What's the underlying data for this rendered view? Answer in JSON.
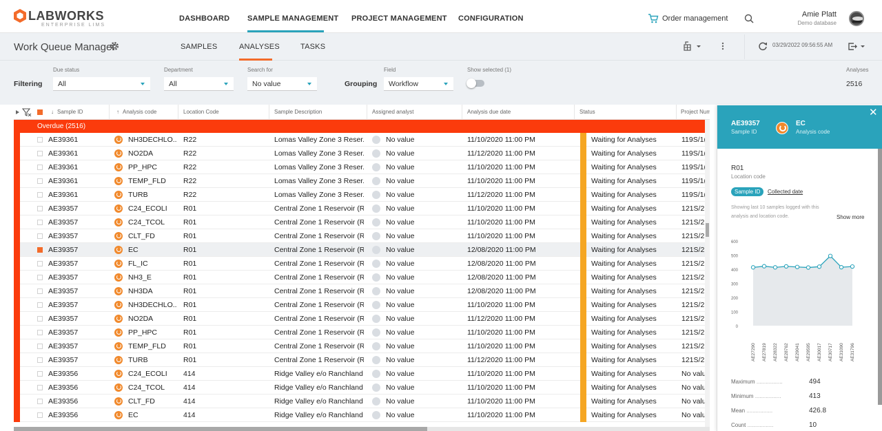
{
  "brand": {
    "name": "LABWORKS",
    "tagline": "ENTERPRISE LIMS"
  },
  "nav": {
    "items": [
      {
        "label": "DASHBOARD"
      },
      {
        "label": "SAMPLE MANAGEMENT",
        "active": true
      },
      {
        "label": "PROJECT MANAGEMENT"
      },
      {
        "label": "CONFIGURATION"
      }
    ],
    "order_label": "Order management",
    "user": {
      "name": "Amie Platt",
      "database": "Demo database"
    }
  },
  "subheader": {
    "title": "Work Queue Manager",
    "tabs": [
      {
        "label": "SAMPLES"
      },
      {
        "label": "ANALYSES",
        "active": true
      },
      {
        "label": "TASKS"
      }
    ],
    "refresh_time": "03/29/2022 09:56:55 AM"
  },
  "filters": {
    "filtering_label": "Filtering",
    "grouping_label": "Grouping",
    "due_status": {
      "label": "Due status",
      "value": "All"
    },
    "department": {
      "label": "Department",
      "value": "All"
    },
    "search_for": {
      "label": "Search for",
      "value": "No value"
    },
    "field": {
      "label": "Field",
      "value": "Workflow"
    },
    "show_selected": {
      "label": "Show selected (1)"
    },
    "analyses": {
      "label": "Analyses",
      "count": "2516"
    }
  },
  "grid": {
    "columns": {
      "sample_id": "Sample ID",
      "analysis_code": "Analysis code",
      "location_code": "Location Code",
      "sample_description": "Sample Description",
      "assigned_analyst": "Assigned analyst",
      "due_date": "Analysis due date",
      "status": "Status",
      "project": "Project Num"
    },
    "group_label": "Overdue (2516)",
    "rows": [
      {
        "sample": "AE39361",
        "analysis": "NH3DECHLO...",
        "loc": "R22",
        "desc": "Lomas Valley Zone 3 Reser...",
        "analyst": "No value",
        "due": "11/10/2020 11:00 PM",
        "status": "Waiting for Analyses",
        "project": "119S/1("
      },
      {
        "sample": "AE39361",
        "analysis": "NO2DA",
        "loc": "R22",
        "desc": "Lomas Valley Zone 3 Reser...",
        "analyst": "No value",
        "due": "11/12/2020 11:00 PM",
        "status": "Waiting for Analyses",
        "project": "119S/1("
      },
      {
        "sample": "AE39361",
        "analysis": "PP_HPC",
        "loc": "R22",
        "desc": "Lomas Valley Zone 3 Reser...",
        "analyst": "No value",
        "due": "11/10/2020 11:00 PM",
        "status": "Waiting for Analyses",
        "project": "119S/1("
      },
      {
        "sample": "AE39361",
        "analysis": "TEMP_FLD",
        "loc": "R22",
        "desc": "Lomas Valley Zone 3 Reser...",
        "analyst": "No value",
        "due": "11/10/2020 11:00 PM",
        "status": "Waiting for Analyses",
        "project": "119S/1("
      },
      {
        "sample": "AE39361",
        "analysis": "TURB",
        "loc": "R22",
        "desc": "Lomas Valley Zone 3 Reser...",
        "analyst": "No value",
        "due": "11/12/2020 11:00 PM",
        "status": "Waiting for Analyses",
        "project": "119S/1("
      },
      {
        "sample": "AE39357",
        "analysis": "C24_ECOLI",
        "loc": "R01",
        "desc": "Central Zone 1 Reservoir (R...",
        "analyst": "No value",
        "due": "11/10/2020 11:00 PM",
        "status": "Waiting for Analyses",
        "project": "121S/2"
      },
      {
        "sample": "AE39357",
        "analysis": "C24_TCOL",
        "loc": "R01",
        "desc": "Central Zone 1 Reservoir (R...",
        "analyst": "No value",
        "due": "11/10/2020 11:00 PM",
        "status": "Waiting for Analyses",
        "project": "121S/2"
      },
      {
        "sample": "AE39357",
        "analysis": "CLT_FD",
        "loc": "R01",
        "desc": "Central Zone 1 Reservoir (R...",
        "analyst": "No value",
        "due": "11/10/2020 11:00 PM",
        "status": "Waiting for Analyses",
        "project": "121S/2"
      },
      {
        "sample": "AE39357",
        "analysis": "EC",
        "loc": "R01",
        "desc": "Central Zone 1 Reservoir (R...",
        "analyst": "No value",
        "due": "12/08/2020 11:00 PM",
        "status": "Waiting for Analyses",
        "project": "121S/2",
        "selected": true
      },
      {
        "sample": "AE39357",
        "analysis": "FL_IC",
        "loc": "R01",
        "desc": "Central Zone 1 Reservoir (R...",
        "analyst": "No value",
        "due": "12/08/2020 11:00 PM",
        "status": "Waiting for Analyses",
        "project": "121S/2"
      },
      {
        "sample": "AE39357",
        "analysis": "NH3_E",
        "loc": "R01",
        "desc": "Central Zone 1 Reservoir (R...",
        "analyst": "No value",
        "due": "12/08/2020 11:00 PM",
        "status": "Waiting for Analyses",
        "project": "121S/2"
      },
      {
        "sample": "AE39357",
        "analysis": "NH3DA",
        "loc": "R01",
        "desc": "Central Zone 1 Reservoir (R...",
        "analyst": "No value",
        "due": "12/08/2020 11:00 PM",
        "status": "Waiting for Analyses",
        "project": "121S/2"
      },
      {
        "sample": "AE39357",
        "analysis": "NH3DECHLO...",
        "loc": "R01",
        "desc": "Central Zone 1 Reservoir (R...",
        "analyst": "No value",
        "due": "11/10/2020 11:00 PM",
        "status": "Waiting for Analyses",
        "project": "121S/2"
      },
      {
        "sample": "AE39357",
        "analysis": "NO2DA",
        "loc": "R01",
        "desc": "Central Zone 1 Reservoir (R...",
        "analyst": "No value",
        "due": "11/12/2020 11:00 PM",
        "status": "Waiting for Analyses",
        "project": "121S/2"
      },
      {
        "sample": "AE39357",
        "analysis": "PP_HPC",
        "loc": "R01",
        "desc": "Central Zone 1 Reservoir (R...",
        "analyst": "No value",
        "due": "11/10/2020 11:00 PM",
        "status": "Waiting for Analyses",
        "project": "121S/2"
      },
      {
        "sample": "AE39357",
        "analysis": "TEMP_FLD",
        "loc": "R01",
        "desc": "Central Zone 1 Reservoir (R...",
        "analyst": "No value",
        "due": "11/10/2020 11:00 PM",
        "status": "Waiting for Analyses",
        "project": "121S/2"
      },
      {
        "sample": "AE39357",
        "analysis": "TURB",
        "loc": "R01",
        "desc": "Central Zone 1 Reservoir (R...",
        "analyst": "No value",
        "due": "11/12/2020 11:00 PM",
        "status": "Waiting for Analyses",
        "project": "121S/2"
      },
      {
        "sample": "AE39356",
        "analysis": "C24_ECOLI",
        "loc": "414",
        "desc": "Ridge Valley e/o Ranchland",
        "analyst": "No value",
        "due": "11/10/2020 11:00 PM",
        "status": "Waiting for Analyses",
        "project": "No valu"
      },
      {
        "sample": "AE39356",
        "analysis": "C24_TCOL",
        "loc": "414",
        "desc": "Ridge Valley e/o Ranchland",
        "analyst": "No value",
        "due": "11/10/2020 11:00 PM",
        "status": "Waiting for Analyses",
        "project": "No valu"
      },
      {
        "sample": "AE39356",
        "analysis": "CLT_FD",
        "loc": "414",
        "desc": "Ridge Valley e/o Ranchland",
        "analyst": "No value",
        "due": "11/10/2020 11:00 PM",
        "status": "Waiting for Analyses",
        "project": "No valu"
      },
      {
        "sample": "AE39356",
        "analysis": "EC",
        "loc": "414",
        "desc": "Ridge Valley e/o Ranchland",
        "analyst": "No value",
        "due": "11/10/2020 11:00 PM",
        "status": "Waiting for Analyses",
        "project": "No valu"
      }
    ]
  },
  "panel": {
    "sample_id": "AE39357",
    "sample_id_label": "Sample ID",
    "analysis_code": "EC",
    "analysis_code_label": "Analysis code",
    "location": "R01",
    "location_label": "Location code",
    "tab_sample": "Sample ID",
    "tab_collected": "Collected date",
    "note": "Showing last 10 samples logged with this analysis and location code.",
    "show_more": "Show more",
    "stats": [
      {
        "label": "Maximum",
        "value": "494"
      },
      {
        "label": "Minimum",
        "value": "413"
      },
      {
        "label": "Mean",
        "value": "426.8"
      },
      {
        "label": "Count",
        "value": "10"
      }
    ]
  },
  "chart_data": {
    "type": "area",
    "categories": [
      "AE27290",
      "AE27819",
      "AE28322",
      "AE28762",
      "AE29041",
      "AE29595",
      "AE30017",
      "AE30717",
      "AE31090",
      "AE31796"
    ],
    "values": [
      413,
      421,
      413,
      420,
      416,
      412,
      418,
      494,
      414,
      419
    ],
    "ylim": [
      0,
      600
    ],
    "yticks": [
      "0",
      "100",
      "200",
      "300",
      "400",
      "500",
      "600"
    ],
    "color": "#2aa3bb",
    "fill": "#e6e9ec"
  },
  "colors": {
    "accent": "#2aa3bb",
    "brand": "#f36b2a",
    "overdue": "#fb3b0c",
    "status": "#f5a623"
  }
}
